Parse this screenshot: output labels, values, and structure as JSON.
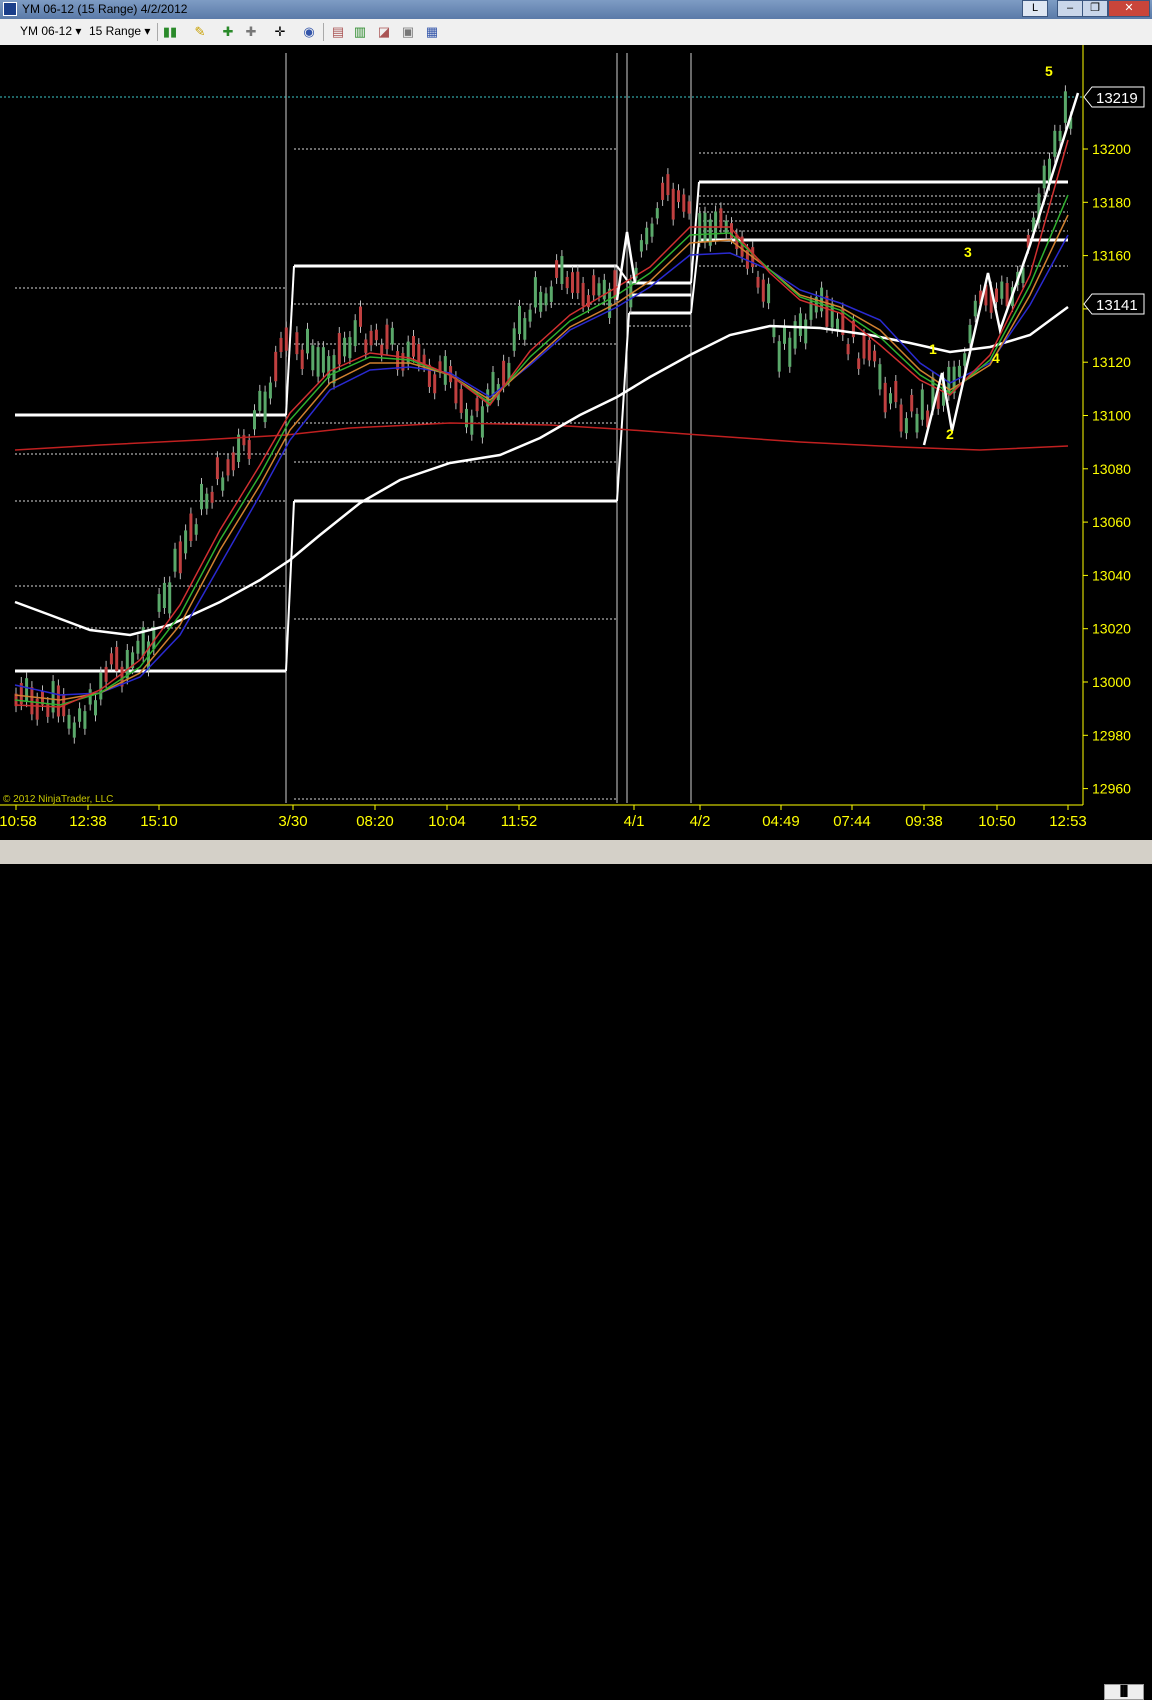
{
  "window": {
    "title": "YM 06-12 (15 Range)  4/2/2012",
    "button_l": "L",
    "min_label": "–",
    "max_label": "❐",
    "close_label": "✕"
  },
  "toolbar": {
    "instrument": "YM 06-12",
    "interval": "15 Range"
  },
  "chart": {
    "copyright": "© 2012 NinjaTrader, LLC",
    "price_ticks": [
      "13200",
      "13180",
      "13160",
      "13140",
      "13120",
      "13100",
      "13080",
      "13060",
      "13040",
      "13020",
      "13000",
      "12980",
      "12960"
    ],
    "time_ticks": [
      "10:58",
      "12:38",
      "15:10",
      "3/30",
      "08:20",
      "10:04",
      "11:52",
      "4/1",
      "4/2",
      "04:49",
      "07:44",
      "09:38",
      "10:50",
      "12:53"
    ],
    "last_price": "13219",
    "marker_price": "13141",
    "wave_labels": [
      "1",
      "2",
      "3",
      "4",
      "5"
    ],
    "colors": {
      "background": "#000000",
      "axis_text": "#ffff00",
      "up_candle": "#5aa86a",
      "down_candle": "#c04040",
      "wave_label": "#ffff00"
    }
  }
}
